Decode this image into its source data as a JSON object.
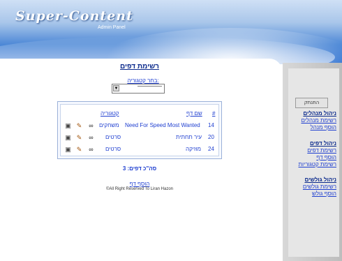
{
  "header": {
    "logo": "Super-Content",
    "subtitle": "Admin Panel"
  },
  "main": {
    "title": "רשימת דפים",
    "category_label": "בחר קטגוריה:",
    "category_value": "—————",
    "table": {
      "headers": {
        "id": "#",
        "name": "שם דף",
        "category": "קטגוריה"
      },
      "rows": [
        {
          "id": "14",
          "name": "Need For Speed Most Wanted",
          "category": "משחקים"
        },
        {
          "id": "20",
          "name": "עיר תחתית",
          "category": "סרטים"
        },
        {
          "id": "24",
          "name": "מוזיקה",
          "category": "סרטים"
        }
      ]
    },
    "total": "סה\"כ דפים: 3",
    "add_page": "הוסף דף",
    "copyright": "©All Right Reserved To Liran Hazon"
  },
  "sidebar": {
    "logout": "התנתק",
    "sections": [
      {
        "title": "ניהול מנהלים",
        "links": [
          "רשימת מנהלים",
          "הוסף מנהל"
        ]
      },
      {
        "title": "ניהול דפים",
        "links": [
          "רשימת דפים",
          "הוסף דף",
          "רשימת קטגוריות"
        ]
      },
      {
        "title": "ניהול גולשים",
        "links": [
          "רשימת גולשים",
          "הוסף גולש"
        ]
      }
    ]
  },
  "colors": {
    "accent": "#1f3fd0",
    "header_blue": "#2b6fd1"
  },
  "icons": {
    "delete": "delete-icon",
    "edit": "edit-icon",
    "view": "view-icon"
  }
}
